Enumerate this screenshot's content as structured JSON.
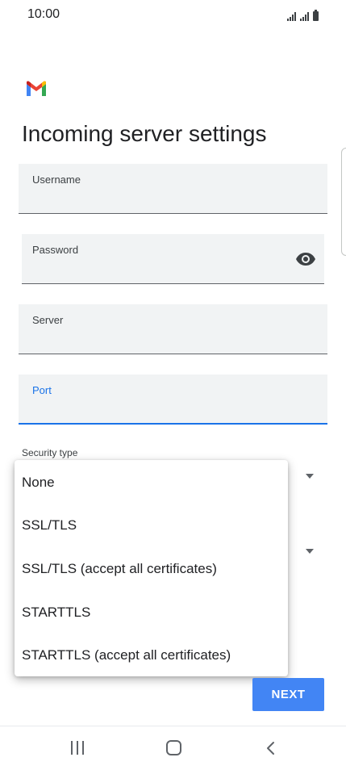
{
  "status_bar": {
    "time": "10:00"
  },
  "header": {
    "title": "Incoming server settings",
    "logo": "gmail-logo"
  },
  "form": {
    "username": {
      "label": "Username",
      "value": ""
    },
    "password": {
      "label": "Password",
      "value": "",
      "toggle_icon": "eye-icon"
    },
    "server": {
      "label": "Server",
      "value": ""
    },
    "port": {
      "label": "Port",
      "value": ""
    },
    "security_type": {
      "label": "Security type"
    }
  },
  "security_menu": {
    "options": [
      "None",
      "SSL/TLS",
      "SSL/TLS (accept all certificates)",
      "STARTTLS",
      "STARTTLS (accept all certificates)"
    ]
  },
  "footer": {
    "next_label": "NEXT"
  },
  "navigation": {
    "icons": [
      "recents-icon",
      "home-icon",
      "back-icon"
    ]
  },
  "colors": {
    "accent": "#1a73e8",
    "button": "#4285f4",
    "field_bg": "#f1f3f4"
  }
}
